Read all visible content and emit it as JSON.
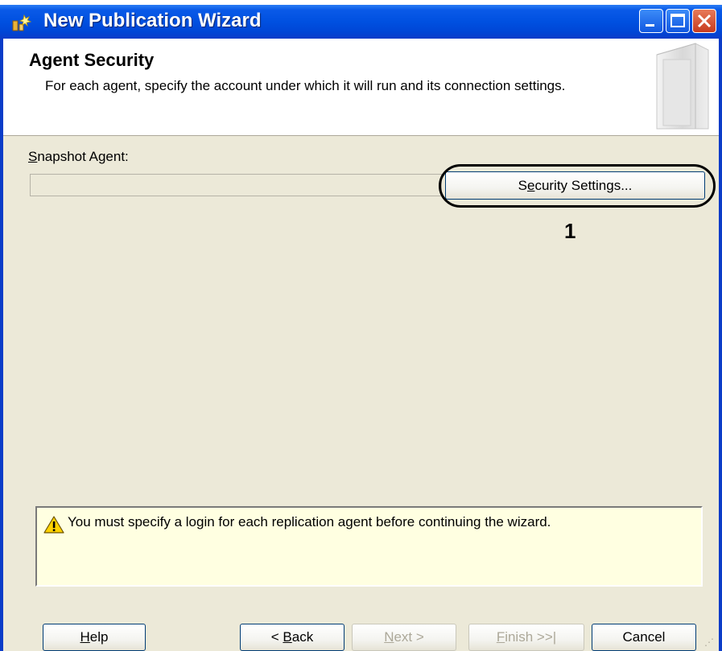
{
  "window": {
    "title": "New Publication Wizard"
  },
  "header": {
    "title": "Agent Security",
    "description": "For each agent, specify the account under which it will run and its connection settings."
  },
  "snapshot_agent": {
    "label_mnemonic": "S",
    "label_rest": "napshot Agent:",
    "value": ""
  },
  "security_button": {
    "pre": "S",
    "mnemonic": "e",
    "post": "curity Settings..."
  },
  "callout_number": "1",
  "message": {
    "text": "You must specify a login for each replication agent before continuing the wizard.",
    "icon": "warning-icon"
  },
  "buttons": {
    "help": {
      "mnemonic": "H",
      "rest": "elp"
    },
    "back": {
      "pre": "< ",
      "mnemonic": "B",
      "post": "ack"
    },
    "next": {
      "mnemonic": "N",
      "post": "ext >"
    },
    "finish": {
      "mnemonic": "F",
      "post": "inish >>|"
    },
    "cancel": "Cancel"
  },
  "colors": {
    "titlebar": "#0050e0",
    "dialog_bg": "#ece9d8",
    "message_bg": "#ffffe1"
  }
}
